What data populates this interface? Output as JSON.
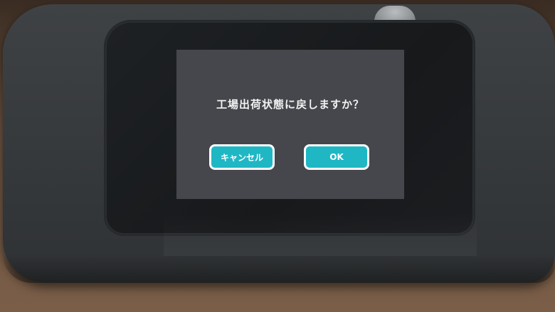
{
  "dialog": {
    "message": "工場出荷状態に戻しますか？",
    "cancel_label": "キャンセル",
    "ok_label": "OK"
  },
  "colors": {
    "screen_background": "#45474c",
    "button_fill": "#1fb7c4",
    "button_border": "#ffffff",
    "device_body": "#3a3d40"
  }
}
